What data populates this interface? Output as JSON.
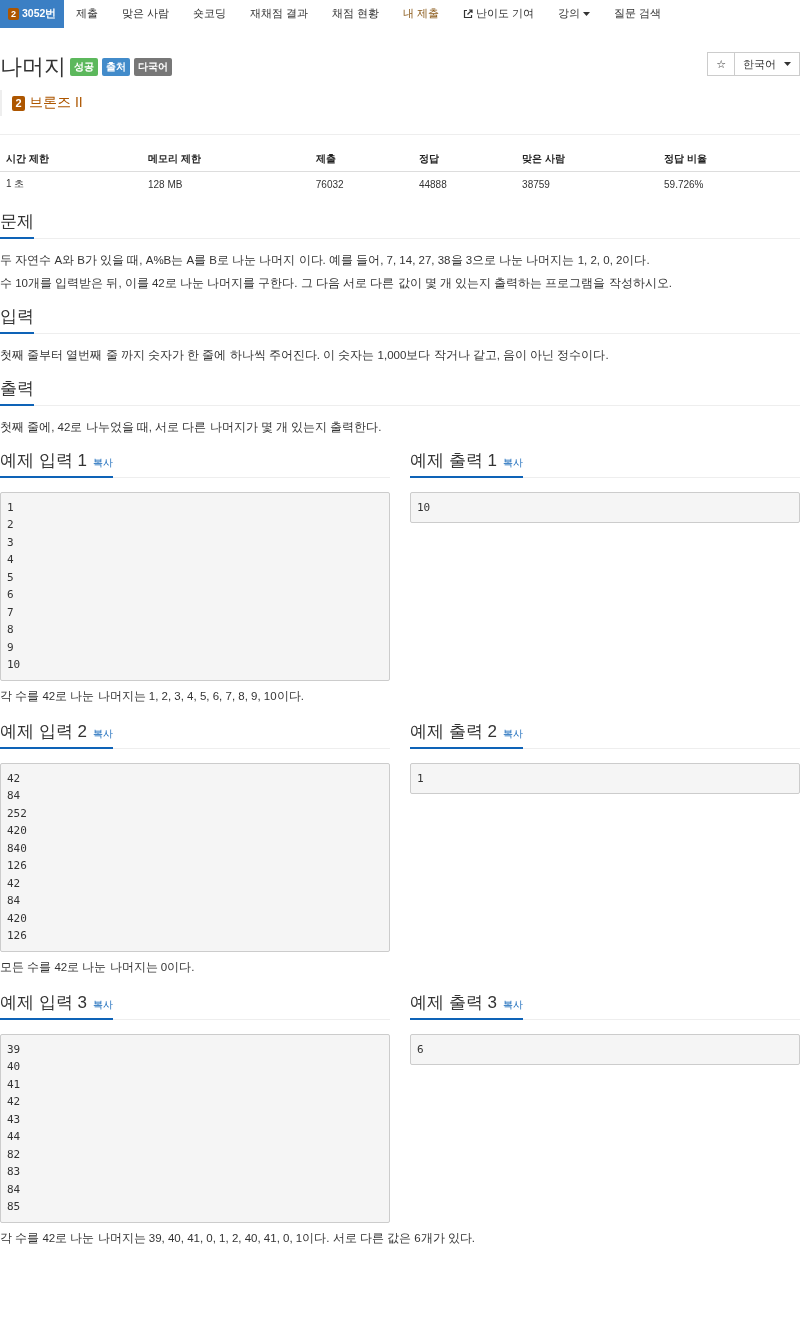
{
  "nav": [
    {
      "label": "3052번",
      "tier": "2",
      "kind": "problem",
      "selected": true,
      "highlight": false
    },
    {
      "label": "제출",
      "kind": "link",
      "selected": false,
      "highlight": false
    },
    {
      "label": "맞은 사람",
      "kind": "link",
      "selected": false,
      "highlight": false
    },
    {
      "label": "숏코딩",
      "kind": "link",
      "selected": false,
      "highlight": false
    },
    {
      "label": "재채점 결과",
      "kind": "link",
      "selected": false,
      "highlight": false
    },
    {
      "label": "채점 현황",
      "kind": "link",
      "selected": false,
      "highlight": false
    },
    {
      "label": "내 제출",
      "kind": "link",
      "selected": false,
      "highlight": true
    },
    {
      "label": "난이도 기여",
      "kind": "external",
      "selected": false,
      "highlight": false
    },
    {
      "label": "강의",
      "kind": "dropdown",
      "selected": false,
      "highlight": false
    },
    {
      "label": "질문 검색",
      "kind": "link",
      "selected": false,
      "highlight": false
    }
  ],
  "title": "나머지",
  "badges": [
    {
      "label": "성공",
      "color": "#5cb85c"
    },
    {
      "label": "출처",
      "color": "#428bca"
    },
    {
      "label": "다국어",
      "color": "#777777"
    }
  ],
  "star_button": "☆",
  "language": "한국어",
  "tier": {
    "level": "2",
    "name": "브론즈 II"
  },
  "stats": {
    "columns": [
      "시간 제한",
      "메모리 제한",
      "제출",
      "정답",
      "맞은 사람",
      "정답 비율"
    ],
    "row": [
      "1 초",
      "128 MB",
      "76032",
      "44888",
      "38759",
      "59.726%"
    ]
  },
  "sections": [
    {
      "heading": "문제",
      "paragraphs": [
        "두 자연수 A와 B가 있을 때, A%B는 A를 B로 나눈 나머지 이다. 예를 들어, 7, 14, 27, 38을 3으로 나눈 나머지는 1, 2, 0, 2이다.",
        "수 10개를 입력받은 뒤, 이를 42로 나눈 나머지를 구한다. 그 다음 서로 다른 값이 몇 개 있는지 출력하는 프로그램을 작성하시오."
      ]
    },
    {
      "heading": "입력",
      "paragraphs": [
        "첫째 줄부터 열번째 줄 까지 숫자가 한 줄에 하나씩 주어진다. 이 숫자는 1,000보다 작거나 같고, 음이 아닌 정수이다."
      ]
    },
    {
      "heading": "출력",
      "paragraphs": [
        "첫째 줄에, 42로 나누었을 때, 서로 다른 나머지가 몇 개 있는지 출력한다."
      ]
    }
  ],
  "examples": [
    {
      "input_heading": "예제 입력 1",
      "input_copy": "복사",
      "input": [
        "1",
        "2",
        "3",
        "4",
        "5",
        "6",
        "7",
        "8",
        "9",
        "10"
      ],
      "output_heading": "예제 출력 1",
      "output_copy": "복사",
      "output": [
        "10"
      ],
      "note": "각 수를 42로 나눈 나머지는 1, 2, 3, 4, 5, 6, 7, 8, 9, 10이다."
    },
    {
      "input_heading": "예제 입력 2",
      "input_copy": "복사",
      "input": [
        "42",
        "84",
        "252",
        "420",
        "840",
        "126",
        "42",
        "84",
        "420",
        "126"
      ],
      "output_heading": "예제 출력 2",
      "output_copy": "복사",
      "output": [
        "1"
      ],
      "note": "모든 수를 42로 나눈 나머지는 0이다."
    },
    {
      "input_heading": "예제 입력 3",
      "input_copy": "복사",
      "input": [
        "39",
        "40",
        "41",
        "42",
        "43",
        "44",
        "82",
        "83",
        "84",
        "85"
      ],
      "output_heading": "예제 출력 3",
      "output_copy": "복사",
      "output": [
        "6"
      ],
      "note": "각 수를 42로 나눈 나머지는 39, 40, 41, 0, 1, 2, 40, 41, 0, 1이다. 서로 다른 값은 6개가 있다."
    }
  ]
}
